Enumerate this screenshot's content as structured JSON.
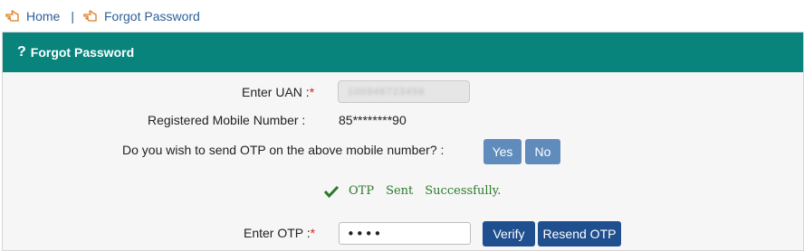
{
  "breadcrumb": {
    "home": "Home",
    "separator": "|",
    "current": "Forgot Password"
  },
  "panel": {
    "title": "Forgot Password",
    "icon": "question-icon"
  },
  "form": {
    "uan_label": "Enter UAN :",
    "required_mark": "*",
    "uan_value_blurred": "100946723456",
    "mobile_label": "Registered Mobile Number :",
    "mobile_value": "85********90",
    "otp_question": "Do you wish to send OTP on the above mobile number? :",
    "yes_label": "Yes",
    "no_label": "No",
    "success_words": [
      "OTP",
      "Sent",
      "Successfully."
    ],
    "otp_label": "Enter OTP :",
    "otp_value": "••••",
    "verify_label": "Verify",
    "resend_label": "Resend OTP"
  },
  "colors": {
    "header": "#08847d",
    "link": "#2b5f9a",
    "success": "#2b7a2b",
    "button_light": "#5f8bbd",
    "button_dark": "#1f4f8e",
    "required": "#d9251c"
  }
}
